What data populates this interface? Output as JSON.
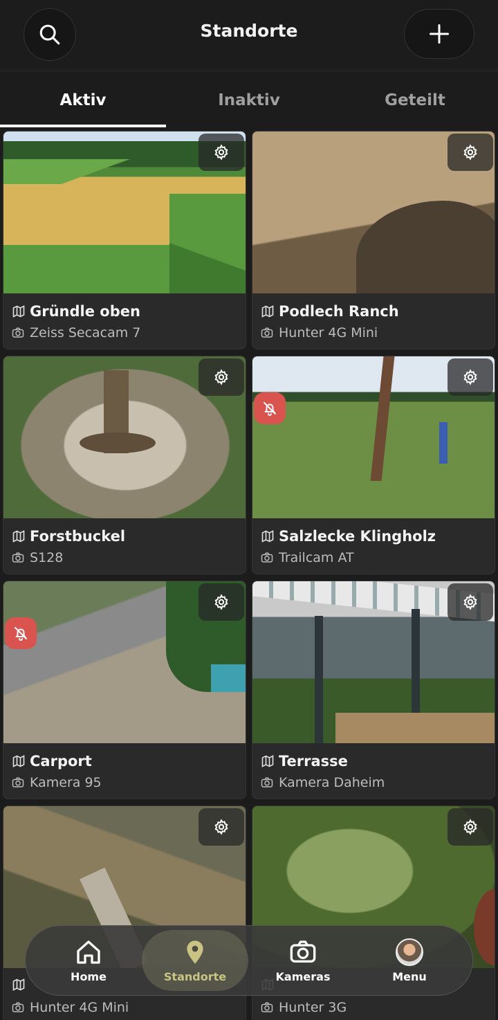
{
  "header": {
    "title": "Standorte",
    "search_icon": "search-icon",
    "add_icon": "plus-icon"
  },
  "tabs": [
    {
      "label": "Aktiv",
      "active": true
    },
    {
      "label": "Inaktiv"
    },
    {
      "label": "Geteilt"
    }
  ],
  "cards": [
    {
      "location": "Gründle oben",
      "camera": "Zeiss Secacam 7",
      "alert": false
    },
    {
      "location": "Podlech Ranch",
      "camera": "Hunter 4G Mini",
      "alert": false
    },
    {
      "location": "Forstbuckel",
      "camera": "S128",
      "alert": false
    },
    {
      "location": "Salzlecke Klingholz",
      "camera": "Trailcam AT",
      "alert": true
    },
    {
      "location": "Carport",
      "camera": "Kamera 95",
      "alert": true
    },
    {
      "location": "Terrasse",
      "camera": "Kamera Daheim",
      "alert": false
    },
    {
      "location": "",
      "camera": "Hunter 4G Mini",
      "alert": false
    },
    {
      "location": "",
      "camera": "Hunter 3G",
      "alert": false
    }
  ],
  "bottom_nav": [
    {
      "label": "Home",
      "icon": "home-icon"
    },
    {
      "label": "Standorte",
      "icon": "location-pin-icon",
      "active": true
    },
    {
      "label": "Kameras",
      "icon": "camera-icon"
    },
    {
      "label": "Menu",
      "icon": "avatar"
    }
  ],
  "colors": {
    "background": "#1c1c1c",
    "card": "#2a2a2a",
    "alert": "#d9534f",
    "nav_active_text": "#c9c384"
  }
}
